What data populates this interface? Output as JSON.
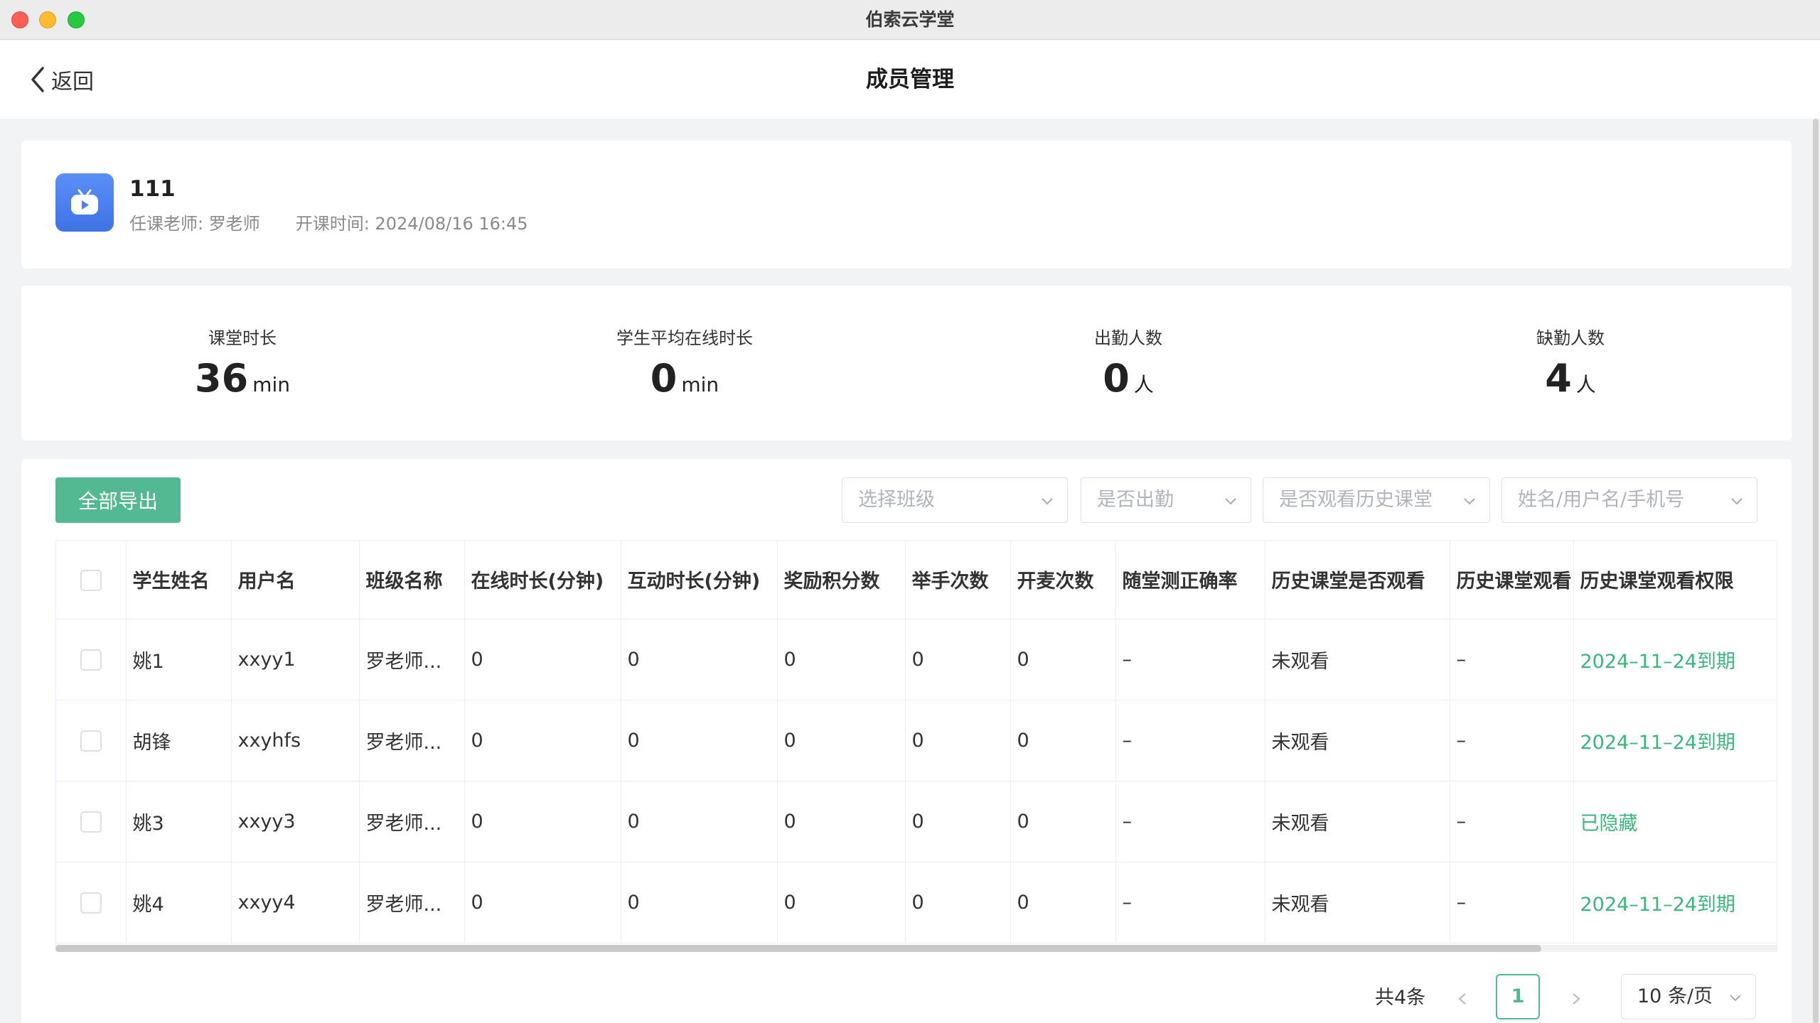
{
  "window": {
    "app_title": "伯索云学堂"
  },
  "header": {
    "back_label": "返回",
    "title": "成员管理"
  },
  "class_info": {
    "name": "111",
    "teacher": "任课老师: 罗老师",
    "start_time": "开课时间: 2024/08/16 16:45"
  },
  "stats": [
    {
      "label": "课堂时长",
      "value": "36",
      "unit": "min"
    },
    {
      "label": "学生平均在线时长",
      "value": "0",
      "unit": "min"
    },
    {
      "label": "出勤人数",
      "value": "0",
      "unit": "人"
    },
    {
      "label": "缺勤人数",
      "value": "4",
      "unit": "人"
    }
  ],
  "toolbar": {
    "export_label": "全部导出",
    "filters": [
      {
        "placeholder": "选择班级"
      },
      {
        "placeholder": "是否出勤"
      },
      {
        "placeholder": "是否观看历史课堂"
      },
      {
        "placeholder": "姓名/用户名/手机号"
      }
    ]
  },
  "table": {
    "columns": [
      "学生姓名",
      "用户名",
      "班级名称",
      "在线时长(分钟)",
      "互动时长(分钟)",
      "奖励积分数",
      "举手次数",
      "开麦次数",
      "随堂测正确率",
      "历史课堂是否观看",
      "历史课堂观看",
      "历史课堂观看权限"
    ],
    "rows": [
      [
        "姚1",
        "xxyy1",
        "罗老师...",
        "0",
        "0",
        "0",
        "0",
        "0",
        "–",
        "未观看",
        "–",
        "2024–11–24到期"
      ],
      [
        "胡锋",
        "xxyhfs",
        "罗老师...",
        "0",
        "0",
        "0",
        "0",
        "0",
        "–",
        "未观看",
        "–",
        "2024–11–24到期"
      ],
      [
        "姚3",
        "xxyy3",
        "罗老师...",
        "0",
        "0",
        "0",
        "0",
        "0",
        "–",
        "未观看",
        "–",
        "已隐藏"
      ],
      [
        "姚4",
        "xxyy4",
        "罗老师...",
        "0",
        "0",
        "0",
        "0",
        "0",
        "–",
        "未观看",
        "–",
        "2024–11–24到期"
      ]
    ]
  },
  "pagination": {
    "total": "共4条",
    "current": "1",
    "page_size": "10 条/页"
  },
  "colors": {
    "accent": "#52b993",
    "link": "#3db57e",
    "icon_blue": "#4a80f0"
  }
}
